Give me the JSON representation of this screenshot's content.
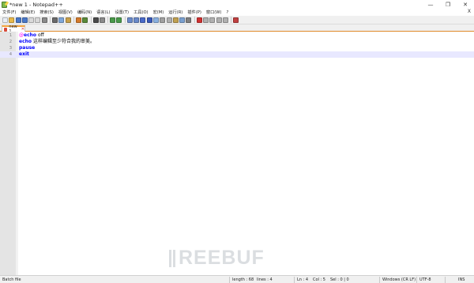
{
  "window": {
    "title": "*new 1 - Notepad++",
    "minimize": "—",
    "restore": "❐",
    "close": "✕"
  },
  "menu": {
    "items": [
      "文件(F)",
      "编辑(E)",
      "搜索(S)",
      "视图(V)",
      "编码(N)",
      "语言(L)",
      "设置(T)",
      "工具(O)",
      "宏(M)",
      "运行(R)",
      "插件(P)",
      "窗口(W)",
      "?"
    ],
    "close_glyph": "X"
  },
  "toolbar": {
    "icons": [
      {
        "name": "new-file-icon",
        "color": "#e9eef5"
      },
      {
        "name": "open-file-icon",
        "color": "#e8b84a"
      },
      {
        "name": "save-icon",
        "color": "#4a78c9"
      },
      {
        "name": "save-all-icon",
        "color": "#4a78c9"
      },
      {
        "name": "close-icon",
        "color": "#d9d9d9"
      },
      {
        "name": "close-all-icon",
        "color": "#d9d9d9"
      },
      {
        "name": "print-icon",
        "color": "#8a8a8a"
      },
      {
        "name": "separator"
      },
      {
        "name": "cut-icon",
        "color": "#6a6a6a"
      },
      {
        "name": "copy-icon",
        "color": "#7fa7d9"
      },
      {
        "name": "paste-icon",
        "color": "#c9a04a"
      },
      {
        "name": "separator"
      },
      {
        "name": "undo-icon",
        "color": "#d47a2a"
      },
      {
        "name": "redo-icon",
        "color": "#5a8a3a"
      },
      {
        "name": "separator"
      },
      {
        "name": "find-icon",
        "color": "#4a4a4a"
      },
      {
        "name": "replace-icon",
        "color": "#8a8a8a"
      },
      {
        "name": "separator"
      },
      {
        "name": "zoom-in-icon",
        "color": "#4a9a4a"
      },
      {
        "name": "zoom-out-icon",
        "color": "#4a9a4a"
      },
      {
        "name": "separator"
      },
      {
        "name": "sync-vertical-icon",
        "color": "#6a8ac9"
      },
      {
        "name": "sync-horizontal-icon",
        "color": "#6a8ac9"
      },
      {
        "name": "word-wrap-icon",
        "color": "#4a6ac9"
      },
      {
        "name": "show-all-chars-icon",
        "color": "#3a5ab9"
      },
      {
        "name": "indent-guide-icon",
        "color": "#8ab0e0"
      },
      {
        "name": "udl-icon",
        "color": "#a0a0a0"
      },
      {
        "name": "doc-map-icon",
        "color": "#b0b0b0"
      },
      {
        "name": "function-list-icon",
        "color": "#c0a050"
      },
      {
        "name": "folder-workspace-icon",
        "color": "#7aa0d0"
      },
      {
        "name": "monitoring-icon",
        "color": "#808080"
      },
      {
        "name": "separator"
      },
      {
        "name": "record-macro-icon",
        "color": "#d03030"
      },
      {
        "name": "stop-record-icon",
        "color": "#b0b0b0"
      },
      {
        "name": "playback-icon",
        "color": "#b0b0b0"
      },
      {
        "name": "run-macro-multiple-icon",
        "color": "#b0b0b0"
      },
      {
        "name": "save-macro-icon",
        "color": "#b0b0b0"
      },
      {
        "name": "separator"
      },
      {
        "name": "spell-check-icon",
        "color": "#c04040"
      }
    ]
  },
  "tab": {
    "label": "new 1",
    "close_glyph": "✕"
  },
  "editor": {
    "lines": [
      {
        "number": "1",
        "tokens": [
          {
            "t": "@",
            "c": "at"
          },
          {
            "t": "echo",
            "c": "kw"
          },
          {
            "t": " off",
            "c": "txt"
          }
        ]
      },
      {
        "number": "2",
        "tokens": [
          {
            "t": "echo",
            "c": "kw"
          },
          {
            "t": " 这样编辑至少符合我的审美。",
            "c": "txt"
          }
        ]
      },
      {
        "number": "3",
        "tokens": [
          {
            "t": "pause",
            "c": "kw"
          }
        ]
      },
      {
        "number": "4",
        "tokens": [
          {
            "t": "exit",
            "c": "kw"
          }
        ],
        "current": true
      }
    ]
  },
  "watermark": {
    "text": "REEBUF"
  },
  "status": {
    "file_type": "Batch file",
    "length": "length : 68",
    "lines": "lines : 4",
    "ln": "Ln : 4",
    "col": "Col : 5",
    "sel": "Sel : 0 | 0",
    "eol": "Windows (CR LF)",
    "encoding": "UTF-8",
    "mode": "INS"
  }
}
